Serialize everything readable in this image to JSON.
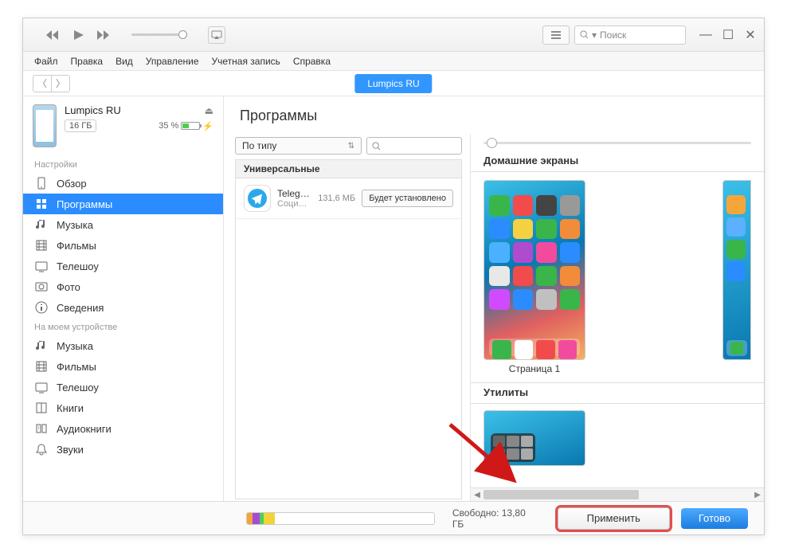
{
  "titlebar": {
    "search_placeholder": "Поиск"
  },
  "menubar": {
    "items": [
      "Файл",
      "Правка",
      "Вид",
      "Управление",
      "Учетная запись",
      "Справка"
    ]
  },
  "toolbar": {
    "device_tab": "Lumpics RU"
  },
  "sidebar": {
    "device": {
      "name": "Lumpics RU",
      "capacity": "16 ГБ",
      "battery_pct": "35 %"
    },
    "section_settings": "Настройки",
    "settings_items": [
      {
        "label": "Обзор",
        "icon": "device"
      },
      {
        "label": "Программы",
        "icon": "apps"
      },
      {
        "label": "Музыка",
        "icon": "music"
      },
      {
        "label": "Фильмы",
        "icon": "film"
      },
      {
        "label": "Телешоу",
        "icon": "tv"
      },
      {
        "label": "Фото",
        "icon": "photo"
      },
      {
        "label": "Сведения",
        "icon": "info"
      }
    ],
    "section_ondevice": "На моем устройстве",
    "ondevice_items": [
      {
        "label": "Музыка",
        "icon": "music"
      },
      {
        "label": "Фильмы",
        "icon": "film"
      },
      {
        "label": "Телешоу",
        "icon": "tv"
      },
      {
        "label": "Книги",
        "icon": "book"
      },
      {
        "label": "Аудиокниги",
        "icon": "audiobook"
      },
      {
        "label": "Звуки",
        "icon": "bell"
      }
    ]
  },
  "content": {
    "title": "Программы",
    "sort_label": "По типу",
    "group_universal": "Универсальные",
    "app": {
      "name": "Teleg…",
      "category": "Соци…",
      "size": "131,6 МБ",
      "action": "Будет установлено"
    },
    "screens_header": "Домашние экраны",
    "page1_label": "Страница 1",
    "utilities_header": "Утилиты"
  },
  "bottom": {
    "free_label": "Свободно: 13,80 ГБ",
    "apply": "Применить",
    "done": "Готово",
    "segments": [
      {
        "color": "#f2a63a",
        "width": "3%"
      },
      {
        "color": "#a74bd6",
        "width": "4%"
      },
      {
        "color": "#4bd05a",
        "width": "2%"
      },
      {
        "color": "#f2d43a",
        "width": "6%"
      }
    ]
  },
  "home_apps_colors": [
    "#3ab54a",
    "#f24b4b",
    "#444",
    "#999",
    "#2a8cff",
    "#f5d142",
    "#3ab54a",
    "#f28c3a",
    "#4bb0ff",
    "#b04bd0",
    "#f24b9e",
    "#2a8cff",
    "#e8e8e8",
    "#f24b4b",
    "#3ab54a",
    "#f28c3a",
    "#d04bff",
    "#2a8cff",
    "#c0c0c0",
    "#3ab54a"
  ],
  "home_apps_colors2": [
    "#f5a63a",
    "#5bb0ff",
    "#3ab54a",
    "#2a8cff"
  ],
  "dock_colors": [
    "#3ab54a",
    "#fff",
    "#f24b4b",
    "#f24b9e"
  ]
}
